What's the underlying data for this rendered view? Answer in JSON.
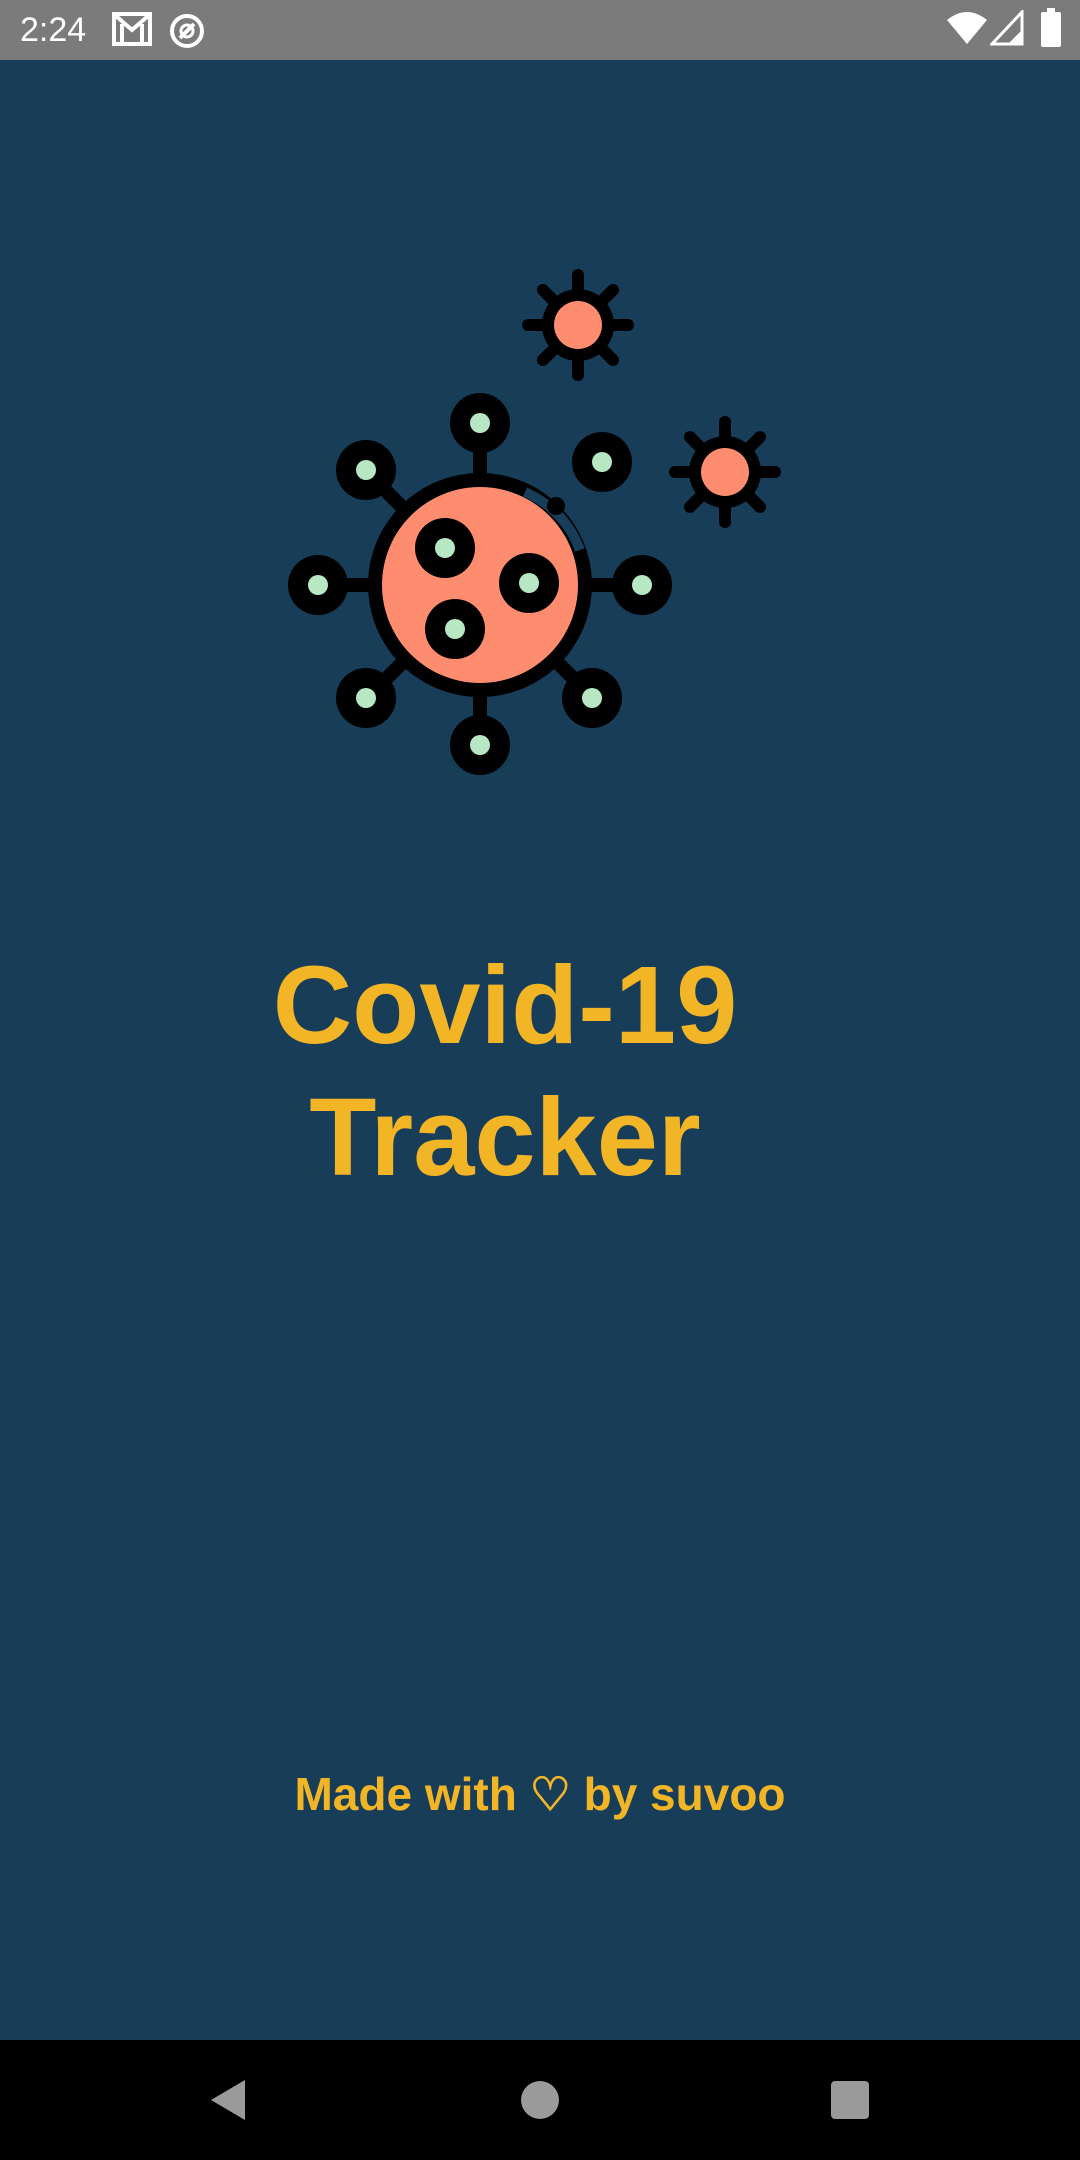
{
  "status_bar": {
    "time": "2:24",
    "icons": [
      "gmail-icon",
      "data-saver-icon",
      "wifi-icon",
      "cell-signal-icon",
      "battery-icon"
    ]
  },
  "splash": {
    "logo_icon": "virus-icon",
    "title_line1": "Covid-19",
    "title_line2": "Tracker",
    "credit": "Made with ♡ by suvoo"
  },
  "nav_bar": {
    "back_icon": "back-triangle-icon",
    "home_icon": "home-circle-icon",
    "recents_icon": "recents-square-icon"
  },
  "colors": {
    "background": "#173d59",
    "accent": "#f2b526",
    "virus_body": "#fe8c6f",
    "virus_spots": "#b7e7c3",
    "status_bar": "#7b7b7b",
    "nav_bar": "#000000"
  }
}
